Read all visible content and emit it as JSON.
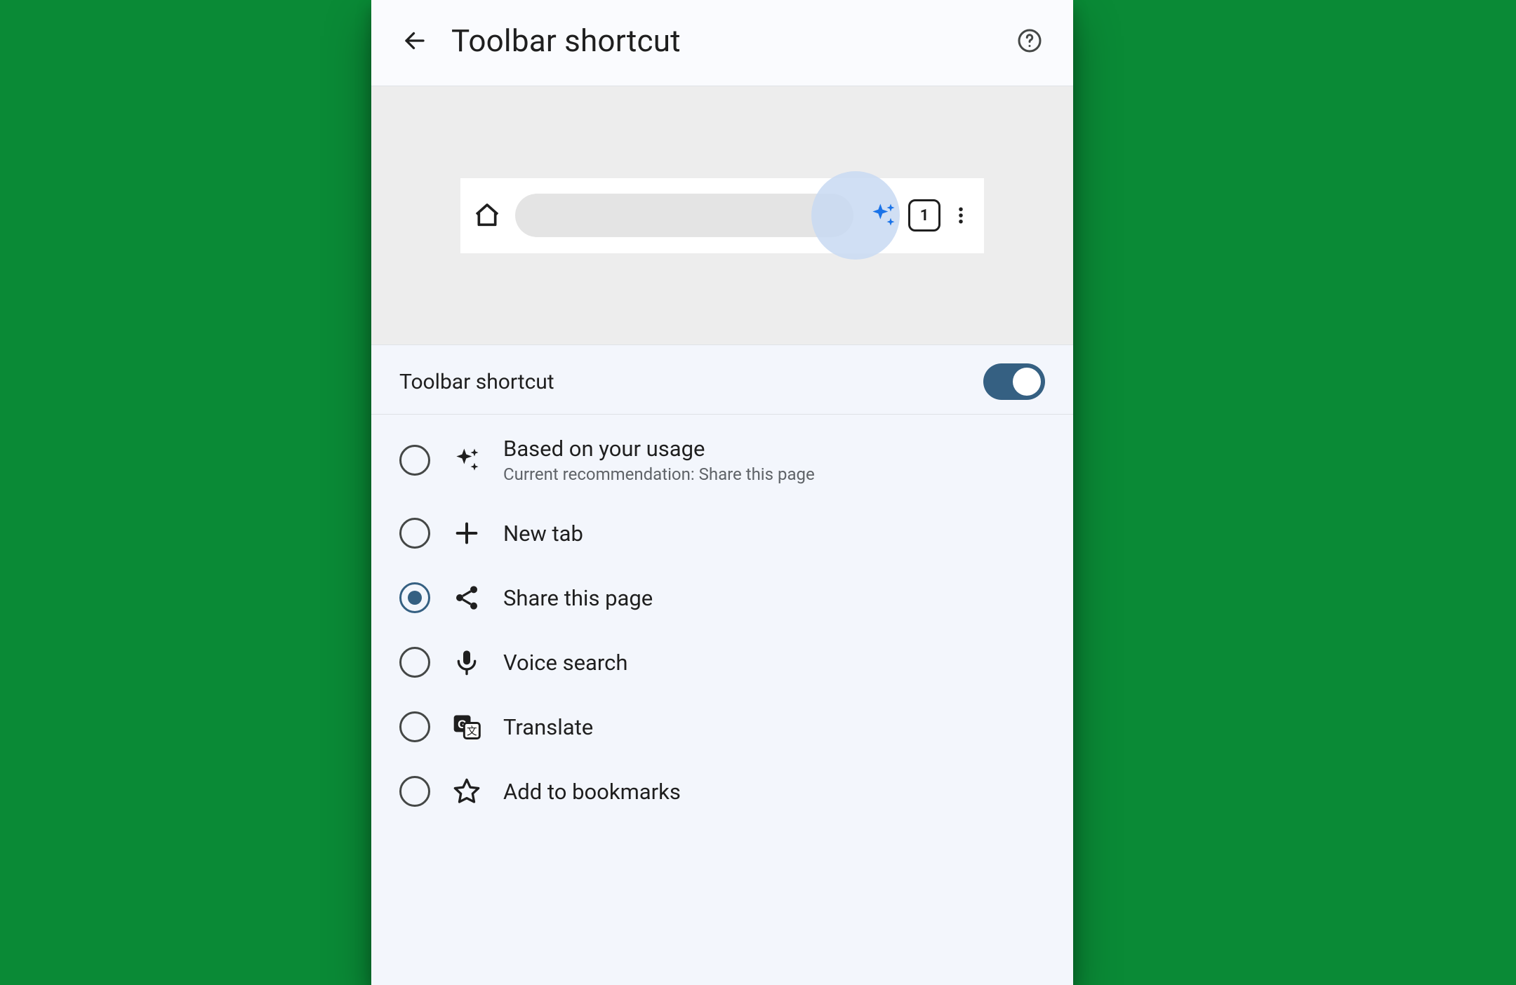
{
  "header": {
    "title": "Toolbar shortcut"
  },
  "preview": {
    "tab_count": "1"
  },
  "toggle": {
    "label": "Toolbar shortcut",
    "on": true
  },
  "options": [
    {
      "id": "based-on-usage",
      "title": "Based on your usage",
      "subtitle": "Current recommendation:  Share this page",
      "icon": "sparkle-icon",
      "selected": false
    },
    {
      "id": "new-tab",
      "title": "New tab",
      "icon": "plus-icon",
      "selected": false
    },
    {
      "id": "share",
      "title": "Share this page",
      "icon": "share-icon",
      "selected": true
    },
    {
      "id": "voice-search",
      "title": "Voice search",
      "icon": "mic-icon",
      "selected": false
    },
    {
      "id": "translate",
      "title": "Translate",
      "icon": "translate-icon",
      "selected": false
    },
    {
      "id": "add-bookmarks",
      "title": "Add to bookmarks",
      "icon": "star-icon",
      "selected": false
    }
  ]
}
